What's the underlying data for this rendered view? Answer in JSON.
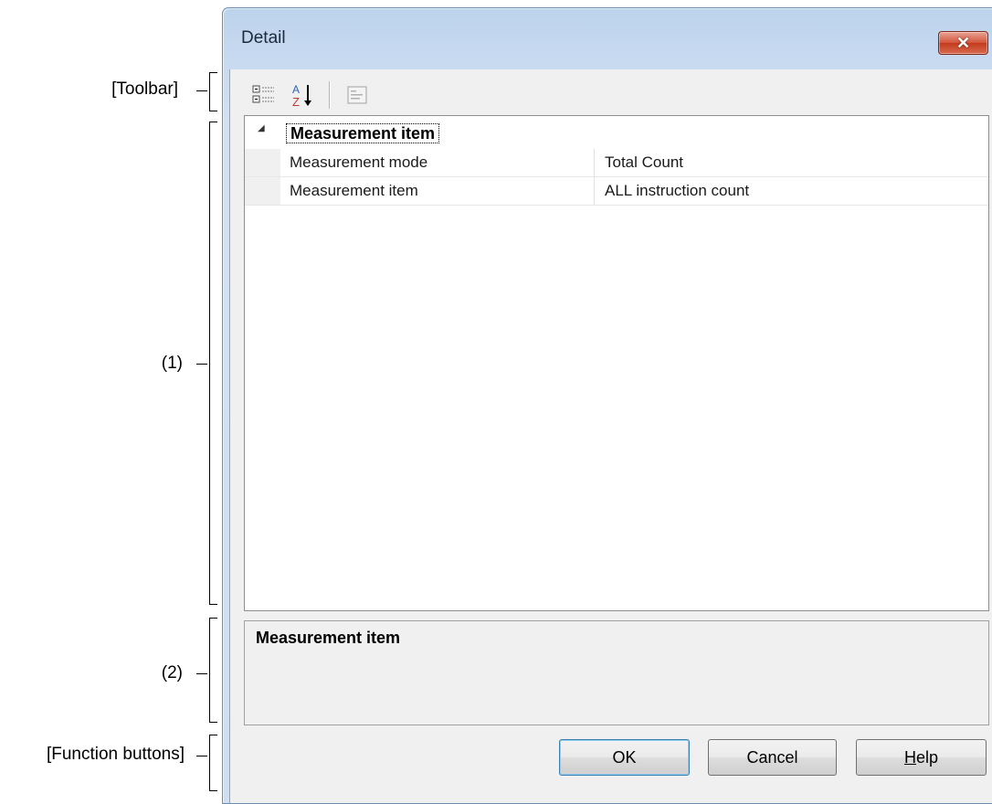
{
  "annotations": {
    "toolbar": "[Toolbar]",
    "grid": "(1)",
    "description": "(2)",
    "function_buttons": "[Function buttons]"
  },
  "window": {
    "title": "Detail",
    "close_symbol": "✕"
  },
  "toolbar": {
    "items": [
      {
        "name": "categorized-view",
        "icon": "categorized-icon"
      },
      {
        "name": "alphabetical-sort",
        "icon": "sort-az-icon"
      },
      {
        "name": "property-pages",
        "icon": "property-pages-icon"
      }
    ]
  },
  "grid": {
    "category": "Measurement item",
    "rows": [
      {
        "name": "Measurement mode",
        "value": "Total Count"
      },
      {
        "name": "Measurement item",
        "value": "ALL instruction count"
      }
    ]
  },
  "description": {
    "title": "Measurement item"
  },
  "buttons": {
    "ok": "OK",
    "cancel": "Cancel",
    "help": "Help"
  },
  "colors": {
    "title_bar": "#c8daf0",
    "close_button": "#d2553b",
    "client_bg": "#f0f0f0",
    "default_button_border": "#3c7fb1"
  }
}
